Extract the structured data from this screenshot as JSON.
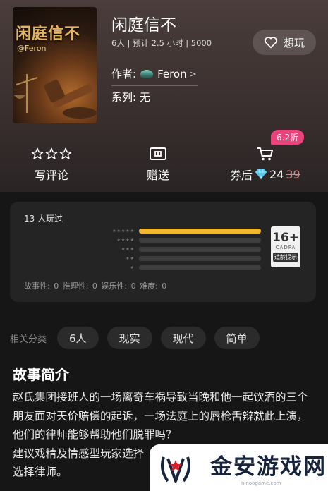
{
  "game": {
    "cover_title": "闲庭信不",
    "cover_brand": "@Feron",
    "title": "闲庭信不",
    "meta": "6人 | 预计 2.5 小时 | 5000",
    "want_label": "想玩",
    "author_label": "作者:",
    "author_name": "Feron",
    "author_chevron": ">",
    "series": "系列: 无"
  },
  "actions": {
    "review_label": "写评论",
    "gift_label": "赠送",
    "buy_label": "券后",
    "discount": "6.2折",
    "price": "24",
    "old_price": "39"
  },
  "stats": {
    "played": "13 人玩过",
    "star_rows": [
      "★★★★★",
      "★★★★",
      "★★★",
      "★★",
      "★"
    ],
    "distribution": [
      1.0,
      0,
      0,
      0,
      0
    ],
    "age_rating": "16+",
    "age_org": "CADPA",
    "age_tip": "适龄提示",
    "attributes": "故事性: 0  推理性: 0  娱乐性: 0  难度: 0"
  },
  "tags": {
    "label": "相关分类",
    "items": [
      "6人",
      "现实",
      "现代",
      "简单"
    ]
  },
  "intro": {
    "heading": "故事简介",
    "text": "赵氏集团接班人的一场离奇车祸导致当晚和他一起饮酒的三个朋友面对天价赔偿的起诉，一场法庭上的唇枪舌辩就此上演，他们的律师能够帮助他们脱罪吗？\n建议戏精及情感型玩家选择\n选择律师。"
  },
  "watermark": {
    "name": "金安游戏网",
    "url": "ninoogame.com"
  },
  "colors": {
    "accent_bar": "#f0b62c",
    "discount_badge": "#e8437a",
    "diamond": "#4fc7e8"
  }
}
